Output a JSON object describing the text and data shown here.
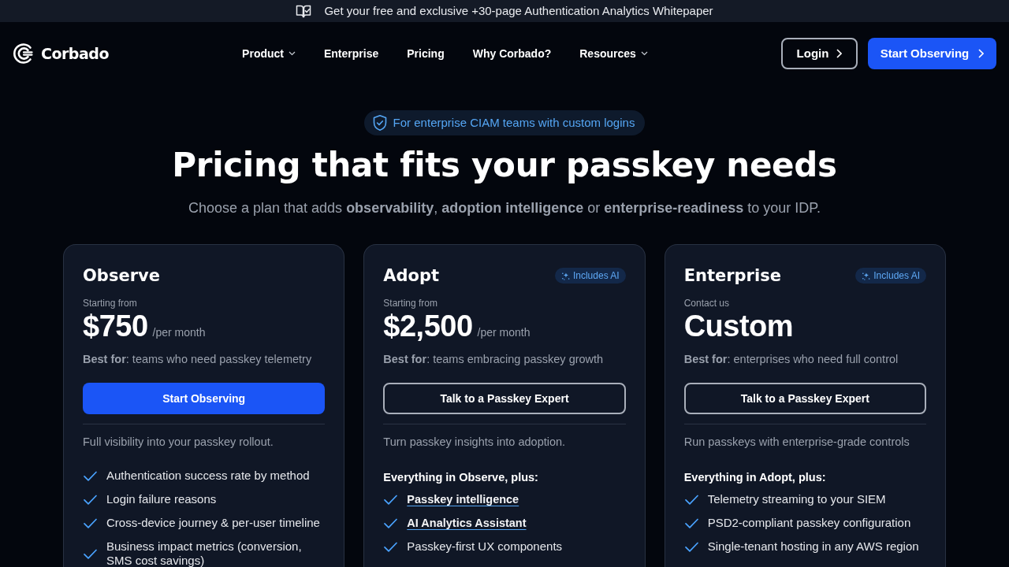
{
  "announcement_bar": {
    "text": "Get your free and exclusive +30-page Authentication Analytics Whitepaper"
  },
  "navbar": {
    "logo_text": "Corbado",
    "links": [
      {
        "label": "Product",
        "dropdown": true
      },
      {
        "label": "Enterprise",
        "dropdown": false
      },
      {
        "label": "Pricing",
        "dropdown": false
      },
      {
        "label": "Why Corbado?",
        "dropdown": false
      },
      {
        "label": "Resources",
        "dropdown": true
      }
    ],
    "login_button": "Login",
    "cta_button": "Start Observing"
  },
  "hero": {
    "badge": "For enterprise CIAM teams with custom logins",
    "title": "Pricing that fits your passkey needs",
    "subtitle": "Choose a plan that adds **observability**, **adoption intelligence** or **enterprise-readiness** to your IDP."
  },
  "plans": [
    {
      "name": "Observe",
      "price_caption": "Starting from",
      "price": "$750",
      "price_unit": "/per month",
      "best_for": "**Best for**: teams who need passkey telemetry",
      "button": {
        "label": "Start Observing",
        "kind": "primary"
      },
      "description": "Full visibility into your passkey rollout.",
      "features": [
        {
          "text": "Authentication success rate by method",
          "kind": "text"
        },
        {
          "text": "Login failure reasons",
          "kind": "text"
        },
        {
          "text": "Cross-device journey & per-user timeline",
          "kind": "text"
        },
        {
          "text": "Business impact metrics (conversion, SMS cost savings)",
          "kind": "text"
        }
      ]
    },
    {
      "name": "Adopt",
      "badge": "Includes AI",
      "price_caption": "Starting from",
      "price": "$2,500",
      "price_unit": "/per month",
      "best_for": "**Best for**: teams embracing passkey growth",
      "button": {
        "label": "Talk to a Passkey Expert",
        "kind": "outline"
      },
      "description": "Turn passkey insights into adoption.",
      "features_heading": "Everything in Observe, plus:",
      "features": [
        {
          "text": "Passkey intelligence",
          "kind": "link"
        },
        {
          "text": "AI Analytics Assistant",
          "kind": "link"
        },
        {
          "text": "Passkey-first UX components",
          "kind": "text"
        }
      ]
    },
    {
      "name": "Enterprise",
      "badge": "Includes AI",
      "price_caption": "Contact us",
      "price": "Custom",
      "best_for": "**Best for**: enterprises who need full control",
      "button": {
        "label": "Talk to a Passkey Expert",
        "kind": "outline"
      },
      "description": "Run passkeys with enterprise-grade controls",
      "features_heading": "Everything in Adopt, plus:",
      "features": [
        {
          "text": "Telemetry streaming to your SIEM",
          "kind": "text"
        },
        {
          "text": "PSD2-compliant passkey configuration",
          "kind": "text"
        },
        {
          "text": "Single-tenant hosting in any AWS region",
          "kind": "text"
        }
      ]
    }
  ]
}
